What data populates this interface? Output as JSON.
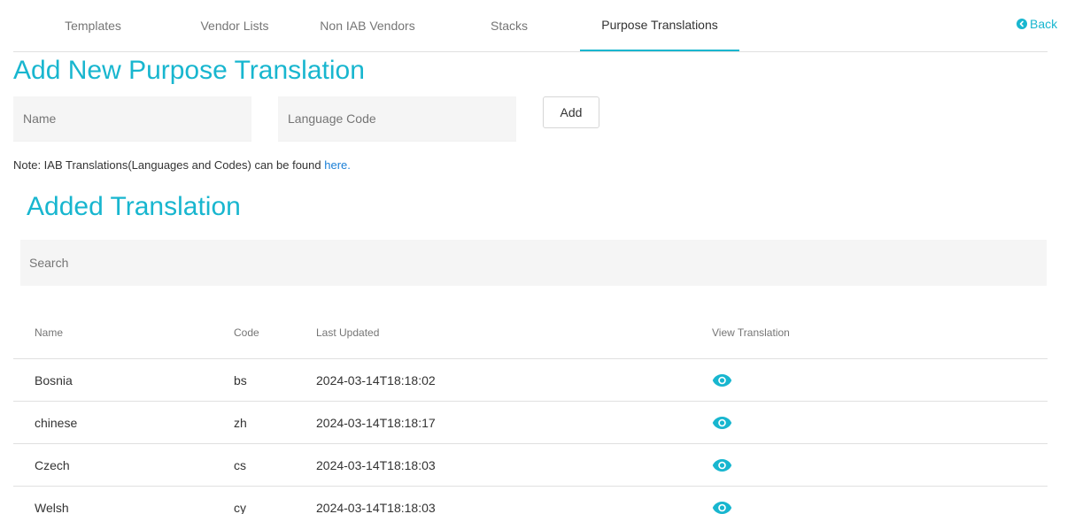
{
  "tabs": [
    {
      "label": "Templates"
    },
    {
      "label": "Vendor Lists"
    },
    {
      "label": "Non IAB Vendors"
    },
    {
      "label": "Stacks"
    },
    {
      "label": "Purpose Translations"
    }
  ],
  "active_tab": "Purpose Translations",
  "back_label": "Back",
  "add_section": {
    "title": "Add New Purpose Translation",
    "name_placeholder": "Name",
    "code_placeholder": "Language Code",
    "add_label": "Add",
    "note_text": "Note: IAB Translations(Languages and Codes) can be found ",
    "note_link": "here."
  },
  "added_section": {
    "title": "Added Translation",
    "search_placeholder": "Search"
  },
  "table": {
    "headers": {
      "name": "Name",
      "code": "Code",
      "updated": "Last Updated",
      "view": "View Translation"
    },
    "rows": [
      {
        "name": "Bosnia",
        "code": "bs",
        "updated": "2024-03-14T18:18:02"
      },
      {
        "name": "chinese",
        "code": "zh",
        "updated": "2024-03-14T18:18:17"
      },
      {
        "name": "Czech",
        "code": "cs",
        "updated": "2024-03-14T18:18:03"
      },
      {
        "name": "Welsh",
        "code": "cy",
        "updated": "2024-03-14T18:18:03"
      }
    ]
  },
  "colors": {
    "accent": "#18b6cf",
    "link": "#1a7fd6",
    "field_bg": "#f5f5f5"
  },
  "icons": {
    "back": "chevron-left-circle-icon",
    "view": "eye-icon"
  }
}
